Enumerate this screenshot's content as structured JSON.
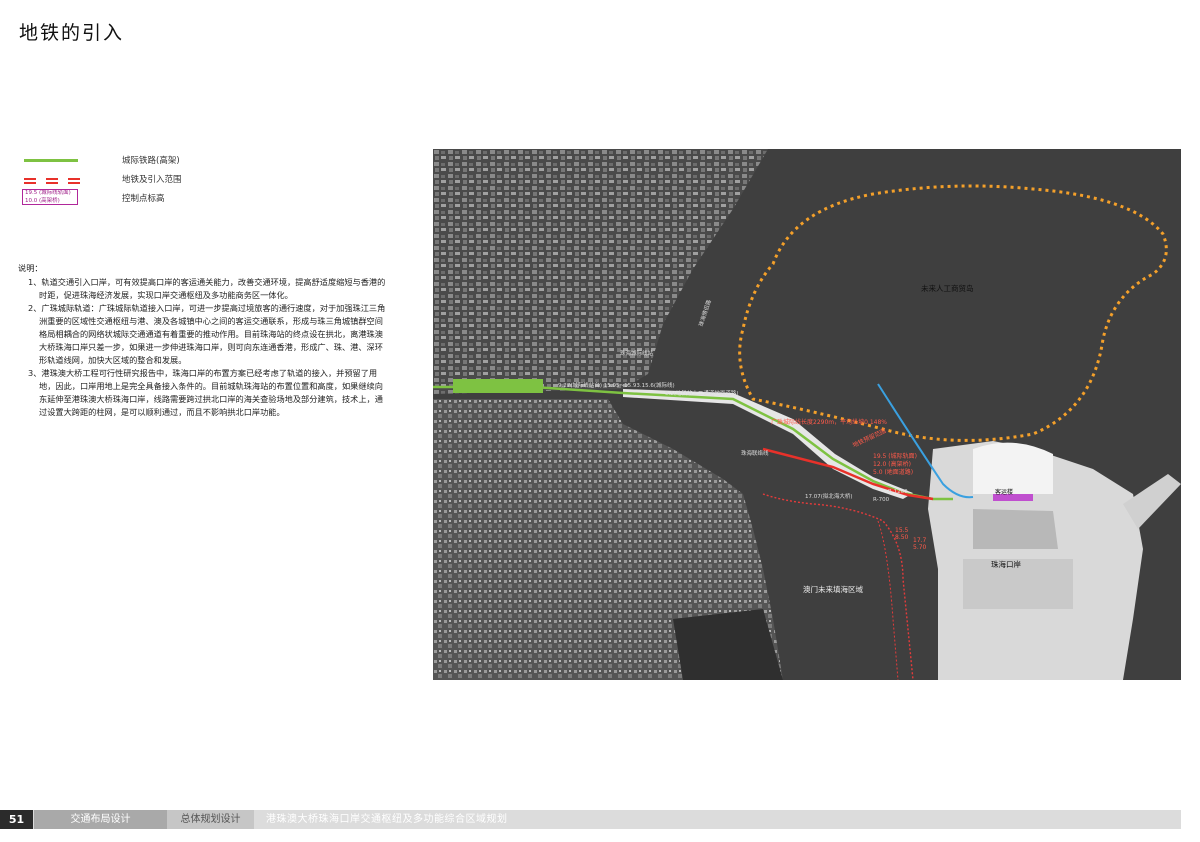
{
  "page": {
    "title": "地铁的引入"
  },
  "legend": {
    "items": [
      {
        "label": "城际铁路(高架)"
      },
      {
        "label": "地铁及引入范围"
      },
      {
        "label": "控制点标高",
        "sample_lines": [
          "19.5 (城际线轨面)",
          "10.0 (高架桥)"
        ]
      }
    ]
  },
  "notes": {
    "head": "说明：",
    "items": [
      "1、轨道交通引入口岸，可有效提高口岸的客运通关能力，改善交通环境，提高舒适度缩短与香港的时距，促进珠海经济发展，实现口岸交通枢纽及多功能商务区一体化。",
      "2、广珠城际轨道：广珠城际轨道接入口岸，可进一步提高过境旅客的通行速度，对于加强珠江三角洲重要的区域性交通枢纽与港、澳及各城镇中心之间的客运交通联系，形成与珠三角城镇群空间格局相耦合的网络状城际交通通道有着重要的推动作用。目前珠海站的终点设在拱北，离港珠澳大桥珠海口岸只差一步，如果进一步伸进珠海口岸，则可向东连通香港，形成广、珠、港、深环形轨道线网，加快大区域的整合和发展。",
      "3、港珠澳大桥工程可行性研究报告中，珠海口岸的布置方案已经考虑了轨道的接入，并预留了用地，因此，口岸用地上是完全具备接入条件的。目前城轨珠海站的布置位置和高度，如果继续向东延伸至港珠澳大桥珠海口岸，线路需要跨过拱北口岸的海关查验场地及部分建筑，技术上，通过设置大跨距的柱网，是可以顺利通过，而且不影响拱北口岸功能。"
    ]
  },
  "map": {
    "labels": {
      "artificial_island": "未来人工商贸岛",
      "macau_reclaim": "澳门未来填海区域",
      "zhuhai_port": "珠海口岸",
      "road_vertical": "珠海情侣路",
      "station_label": "珠海城际线站",
      "elev_a": "9.27(城际线站台) 15.95~15.93.15.6(城际线)",
      "elev_b": "5.5(地铁站上二通道地面道路)",
      "line_length": "广珠城际线长度2290m，平均纵坡0.148%",
      "metro_range": "地铁预留范围",
      "elev_c": "19.5 (城际轨面)",
      "elev_d": "12.0 (高架桥)",
      "elev_e": "5.0 (地面道路)",
      "connection_line": "珠海联络线",
      "elev_f": "17.07(拟北海大桥)",
      "elev_g": "15.5",
      "elev_h": "8.50",
      "elev_i": "17.7",
      "elev_j": "5.70",
      "slope_a": "R-1200",
      "slope_b": "R-700",
      "port_building": "客运楼",
      "road_label": "拱北口岸"
    }
  },
  "footer": {
    "page_number": "51",
    "section": "交通布局设计",
    "subsection": "总体规划设计",
    "project": "港珠澳大桥珠海口岸交通枢纽及多功能综合区域规划"
  }
}
